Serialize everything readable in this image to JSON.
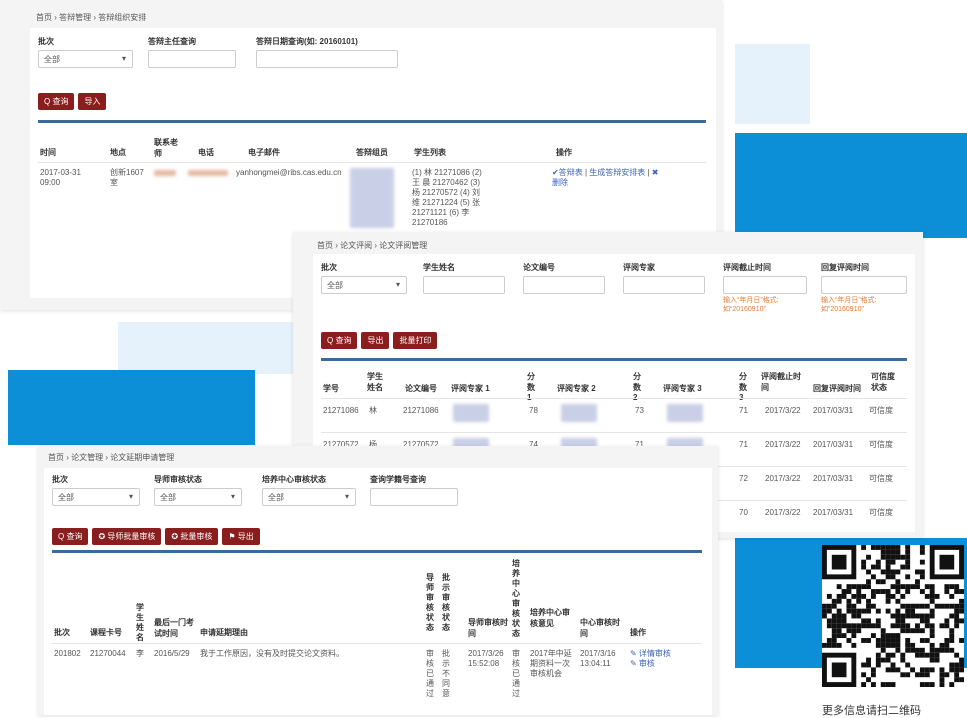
{
  "colors": {
    "accent_blue": "#0d8fd8",
    "light_blue": "#e6f2fb",
    "btn_red": "#8a1d1d",
    "table_rule": "#3a6a9a",
    "hint_orange": "#e07b39"
  },
  "s1": {
    "breadcrumb": "首页 › 答辩管理 › 答辩组织安排",
    "filters": {
      "batch_label": "批次",
      "batch_value": "全部",
      "chair_label": "答辩主任查询",
      "date_label": "答辩日期查询(如: 20160101)"
    },
    "buttons": {
      "search": "Q 查询",
      "import": "导入"
    },
    "headers": [
      "时间",
      "地点",
      "联系老师",
      "电话",
      "电子邮件",
      "答辩组员",
      "学生列表",
      "操作"
    ],
    "row": {
      "time": "2017-03-31 09:00",
      "place": "创新1607 室",
      "email": "yanhongmei@ribs.cas.edu.cn",
      "students": "(1) 林 21271086 (2) 王 晨 21270462 (3) 杨 21270572 (4) 刘 维 21271224 (5) 张 21271121 (6) 李 21270186",
      "action_main": "✔答辩表",
      "action_sep": "|",
      "action_second": "生成答辩安排表",
      "action_delete": "✖ 删除"
    }
  },
  "s2": {
    "breadcrumb": "首页 › 论文评阅 › 论文评阅管理",
    "filters": {
      "batch_label": "批次",
      "batch_value": "全部",
      "student_label": "学生姓名",
      "paper_label": "论文编号",
      "expert_label": "评阅专家",
      "deadline_label": "评阅截止时间",
      "return_label": "回复评阅时间",
      "hint_deadline": "输入“年月日”格式: 如“20160910”",
      "hint_return": "输入“年月日”格式: 如“20160910”"
    },
    "buttons": {
      "search": "Q 查询",
      "export": "导出",
      "batch_print": "批量打印"
    },
    "headers": [
      "学号",
      "学生姓名",
      "论文编号",
      "评阅专家 1",
      "分数 1",
      "评阅专家 2",
      "分数 2",
      "评阅专家 3",
      "分数 3",
      "评阅截止时间",
      "回复评阅时间",
      "可信度状态"
    ],
    "rows": [
      {
        "id": "21271086",
        "name": "林",
        "paper": "21271086",
        "s1": "78",
        "s2": "73",
        "s3": "71",
        "deadline": "2017/3/22",
        "reply": "2017/03/31",
        "status": "可信度"
      },
      {
        "id": "21270572",
        "name": "杨",
        "paper": "21270572",
        "s1": "74",
        "s2": "71",
        "s3": "71",
        "deadline": "2017/3/22",
        "reply": "2017/03/31",
        "status": "可信度"
      },
      {
        "id": "",
        "name": "",
        "paper": "",
        "s1": "",
        "s2": "",
        "s3": "72",
        "deadline": "2017/3/22",
        "reply": "2017/03/31",
        "status": "可信度"
      },
      {
        "id": "",
        "name": "",
        "paper": "",
        "s1": "",
        "s2": "",
        "s3": "70",
        "deadline": "2017/3/22",
        "reply": "2017/03/31",
        "status": "可信度"
      }
    ]
  },
  "s3": {
    "breadcrumb": "首页 › 论文管理 › 论文延期申请管理",
    "filters": {
      "batch_label": "批次",
      "batch_value": "全部",
      "tutor_label": "导师审核状态",
      "tutor_value": "全部",
      "center_label": "培养中心审核状态",
      "center_value": "全部",
      "sid_label": "查询学籍号查询"
    },
    "buttons": {
      "search": "Q 查询",
      "tutor_batch": "✪ 导师批量审核",
      "batch_review": "✪ 批量审核",
      "export": "⚑ 导出"
    },
    "headers": {
      "batch": "批次",
      "id": "课程卡号",
      "name": "学生姓名",
      "exam": "最后一门考试时间",
      "reason": "申请延期理由",
      "tutor_status": "导师审核状态",
      "reply_status": "批示审核状态",
      "tutor_time": "导师审核时间",
      "center_status": "培养中心审核状态",
      "center_opinion": "培养中心审核意见",
      "center_time": "中心审核时间",
      "ops": "操作"
    },
    "row": {
      "batch": "201802",
      "id": "21270044",
      "name": "李",
      "exam": "2016/5/29",
      "reason": "我于工作原因，没有及时提交论文资料。",
      "tutor_status": "审核已通过",
      "reply_status": "批示不同意",
      "tutor_time": "2017/3/26 15:52:08",
      "center_status": "审核已通过",
      "center_opinion": "2017年中延期资料一次审核机会",
      "center_time": "2017/3/16 13:04:11",
      "op1": "✎ 详情审核",
      "op2": "✎ 审核"
    }
  },
  "qr_caption": "更多信息请扫二维码"
}
